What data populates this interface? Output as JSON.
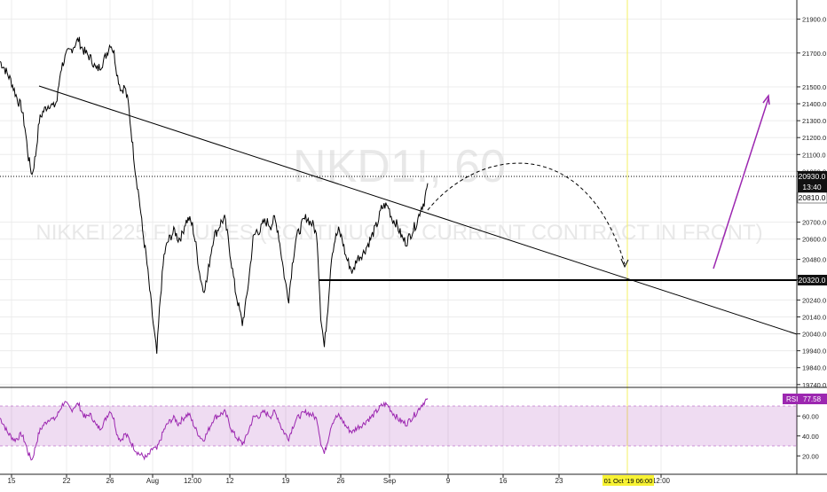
{
  "watermark": {
    "symbol": "NKD1!, 60",
    "description": "NIKKEI 225 FUTURES (CONTINUOUS: CURRENT CONTRACT IN FRONT)"
  },
  "price_axis": {
    "ticks": [
      "21900.0",
      "21700.0",
      "21500.0",
      "21400.0",
      "21300.0",
      "21200.0",
      "21100.0",
      "21000.0",
      "20700.0",
      "20600.0",
      "20480.0",
      "20360.0",
      "20240.0",
      "20140.0",
      "20040.0",
      "19940.0",
      "19840.0",
      "19740.0"
    ]
  },
  "time_axis": {
    "ticks": [
      "15",
      "22",
      "26",
      "Aug",
      "12:00",
      "12",
      "19",
      "26",
      "Sep",
      "9",
      "16",
      "23",
      "12:00"
    ],
    "cursor_label": "01 Oct '19   06:00"
  },
  "badges": {
    "last_price": "20930.0",
    "countdown": "13:40",
    "mid_price": "20810.0",
    "support_price": "20320.0"
  },
  "rsi": {
    "label": "RSI",
    "value": "77.58",
    "ticks": [
      "60.00",
      "40.00",
      "20.00"
    ]
  },
  "colors": {
    "background": "#ffffff",
    "grid": "#ececec",
    "price": "#000000",
    "trendline": "#000000",
    "support_line": "#000000",
    "projection": "#000000",
    "target_arrow": "#9c27b0",
    "rsi_line": "#9c27b0",
    "rsi_band": "#9c27b0",
    "cursor_line": "#f5f066",
    "cursor_label_bg": "#f7f233",
    "watermark": "#d6d6d6"
  },
  "chart_data": [
    {
      "type": "line",
      "title": "NKD1!, 60",
      "subtitle": "NIKKEI 225 FUTURES (CONTINUOUS: CURRENT CONTRACT IN FRONT)",
      "xlabel": "",
      "ylabel": "",
      "x_ticks": [
        "15",
        "22",
        "26",
        "Aug",
        "12:00",
        "12",
        "19",
        "26",
        "Sep",
        "9",
        "16",
        "23",
        "12:00"
      ],
      "ylim": [
        19700,
        21980
      ],
      "grid": true,
      "series": [
        {
          "values": [
            21650,
            21620,
            21580,
            21540,
            21480,
            21420,
            21380,
            21260,
            21080,
            20980,
            21100,
            21300,
            21350,
            21380,
            21400,
            21380,
            21420,
            21600,
            21660,
            21700,
            21720,
            21750,
            21780,
            21730,
            21700,
            21680,
            21650,
            21600,
            21620,
            21650,
            21700,
            21760,
            21700,
            21560,
            21480,
            21500,
            21400,
            21200,
            21000,
            20850,
            20650,
            20500,
            20300,
            20100,
            19920,
            20260,
            20500,
            20580,
            20620,
            20650,
            20600,
            20620,
            20700,
            20720,
            20680,
            20560,
            20400,
            20300,
            20350,
            20500,
            20620,
            20650,
            20700,
            20720,
            20600,
            20450,
            20300,
            20200,
            20100,
            20220,
            20400,
            20600,
            20650,
            20650,
            20700,
            20700,
            20680,
            20720,
            20650,
            20500,
            20350,
            20250,
            20450,
            20600,
            20650,
            20700,
            20730,
            20700,
            20680,
            20600,
            20150,
            19960,
            20200,
            20500,
            20600,
            20650,
            20600,
            20500,
            20450,
            20400,
            20480,
            20500,
            20520,
            20560,
            20600,
            20650,
            20700,
            20780,
            20800,
            20790,
            20720,
            20700,
            20650,
            20600,
            20580,
            20620,
            20660,
            20700,
            20780,
            20820,
            20930
          ]
        }
      ],
      "annotations": {
        "trendline": [
          {
            "x": "Jul 18",
            "y": 21450
          },
          {
            "x": "Oct 1",
            "y": 20320
          }
        ],
        "support_level": 20320,
        "projection": "dashed curve from 20810 up to about 21060 then down to 20370",
        "target_arrow": [
          {
            "y": 20380
          },
          {
            "y": 21400
          }
        ]
      }
    },
    {
      "type": "line",
      "title": "RSI",
      "ylim": [
        10,
        90
      ],
      "band": [
        30,
        70
      ],
      "series": [
        {
          "name": "RSI",
          "values": [
            58,
            52,
            44,
            40,
            36,
            38,
            42,
            34,
            22,
            16,
            30,
            44,
            50,
            54,
            58,
            56,
            60,
            68,
            74,
            70,
            66,
            70,
            72,
            64,
            58,
            62,
            58,
            50,
            48,
            52,
            60,
            66,
            56,
            40,
            36,
            42,
            38,
            32,
            26,
            22,
            20,
            18,
            22,
            28,
            26,
            36,
            46,
            52,
            56,
            58,
            52,
            56,
            60,
            62,
            54,
            46,
            40,
            36,
            42,
            50,
            58,
            60,
            62,
            64,
            56,
            46,
            40,
            36,
            32,
            38,
            48,
            58,
            60,
            60,
            64,
            62,
            60,
            64,
            58,
            48,
            42,
            38,
            48,
            56,
            60,
            62,
            64,
            62,
            60,
            56,
            34,
            22,
            36,
            52,
            58,
            60,
            56,
            50,
            46,
            44,
            48,
            50,
            52,
            56,
            58,
            62,
            66,
            70,
            72,
            70,
            64,
            60,
            56,
            54,
            52,
            56,
            60,
            64,
            70,
            74,
            77.58
          ]
        }
      ]
    }
  ]
}
